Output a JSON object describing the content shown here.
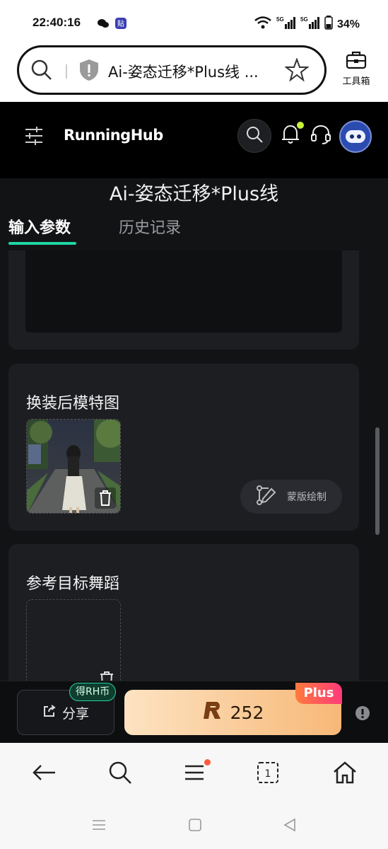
{
  "status_bar": {
    "time": "22:40:16",
    "battery": "34%",
    "icons": [
      "wechat-icon",
      "app-badge-icon",
      "wifi-icon",
      "5g-signal-icon",
      "5g-signal-icon",
      "battery-icon"
    ]
  },
  "browser": {
    "address_title": "Ai-姿态迁移*Plus线 ...",
    "toolbox_label": "工具箱"
  },
  "site": {
    "logo": "RunningHub",
    "page_title": "Ai-姿态迁移*Plus线",
    "tabs": [
      {
        "label": "输入参数",
        "active": true
      },
      {
        "label": "历史记录",
        "active": false
      }
    ],
    "accent_color": "#1fd6a3"
  },
  "model_card": {
    "label": "换装后模特图",
    "mask_button": "蒙版绘制"
  },
  "ref_card": {
    "label": "参考目标舞蹈"
  },
  "action_bar": {
    "share_label": "分享",
    "earn_badge": "得RH币",
    "run_value": "252",
    "plus_badge": "Plus"
  }
}
